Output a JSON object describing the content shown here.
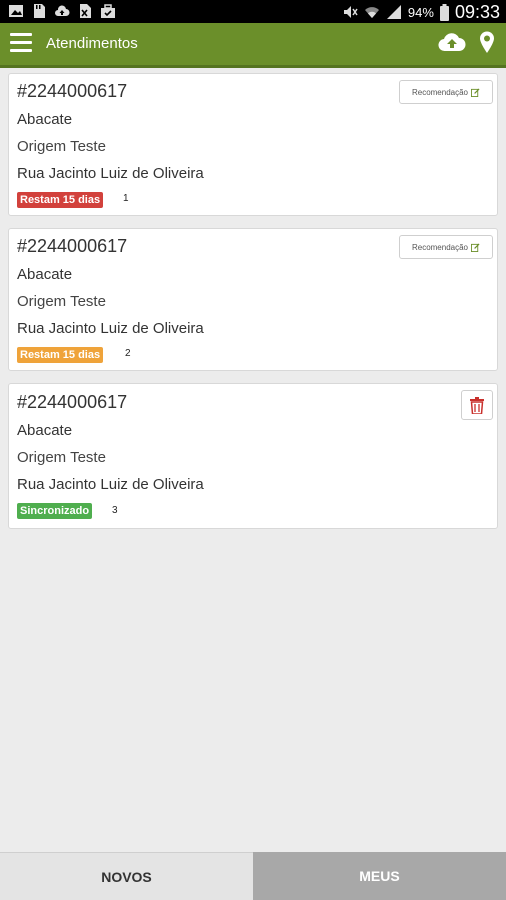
{
  "status_bar": {
    "battery": "94%",
    "time": "09:33",
    "left_icons": [
      "image-icon",
      "sd-card-icon",
      "cloud-upload-icon",
      "excel-icon",
      "briefcase-icon"
    ],
    "right_icons": [
      "mute-icon",
      "wifi-icon",
      "signal-icon",
      "battery-icon"
    ]
  },
  "appbar": {
    "title": "Atendimentos",
    "color": "#6b8f2a",
    "icons": [
      "menu-icon",
      "cloud-upload-icon",
      "location-pin-icon"
    ]
  },
  "cards": [
    {
      "number": "#2244000617",
      "line1": "Abacate",
      "line2": "Origem Teste",
      "line3": "Rua Jacinto Luiz de Oliveira",
      "badge": "Restam 15 dias",
      "badge_color": "#d2413c",
      "index": "1",
      "action": "Recomendação"
    },
    {
      "number": "#2244000617",
      "line1": "Abacate",
      "line2": "Origem Teste",
      "line3": "Rua Jacinto Luiz de Oliveira",
      "badge": "Restam 15 dias",
      "badge_color": "#efa33a",
      "index": "2",
      "action": "Recomendação"
    },
    {
      "number": "#2244000617",
      "line1": "Abacate",
      "line2": "Origem Teste",
      "line3": "Rua Jacinto Luiz de Oliveira",
      "badge": "Sincronizado",
      "badge_color": "#4fae4e",
      "index": "3",
      "action_icon": "trash-icon"
    }
  ],
  "tabs": {
    "novos": "NOVOS",
    "meus": "MEUS",
    "active": "meus"
  }
}
